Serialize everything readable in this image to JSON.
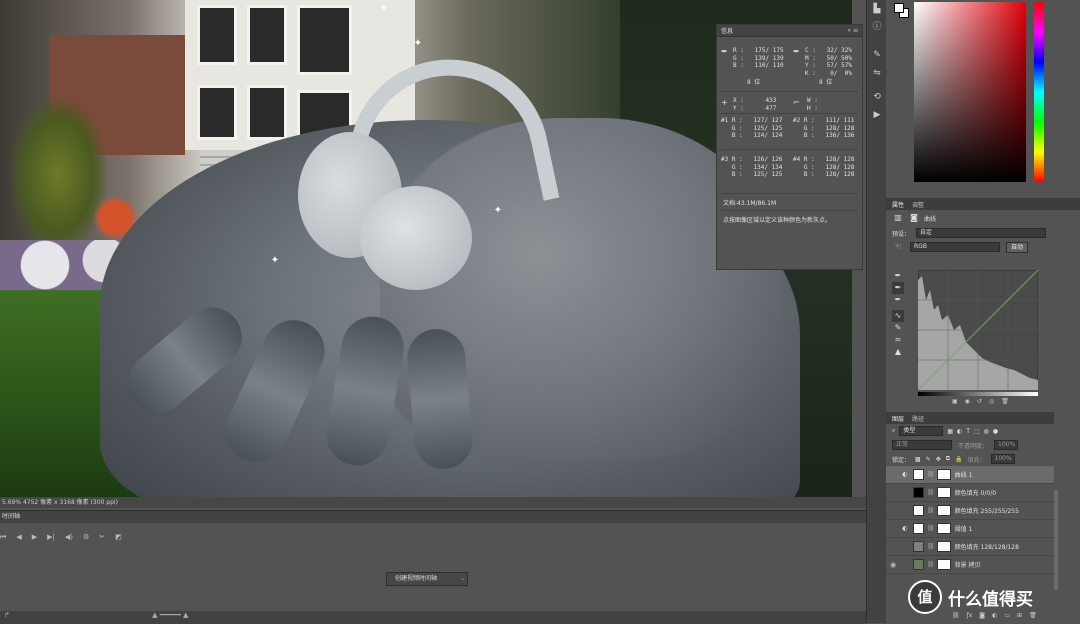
{
  "info_panel": {
    "title": "信息",
    "rgb_block": "R :   175/ 175\nG :   139/ 139\nB :   110/ 110",
    "bit_left": "8 位",
    "cmyk_block": "C :   32/ 32%\nM :   50/ 50%\nY :   57/ 57%\nK :    0/  0%",
    "bit_right": "8 位",
    "xy_block": "X :      433\nY :      477",
    "wh_block": "W :\nH :",
    "s1": "#1 R :   127/ 127\n   G :   125/ 125\n   B :   124/ 124",
    "s2": "#2 R :   111/ 111\n   G :   128/ 128\n   B :   136/ 136",
    "s3": "#3 R :   126/ 126\n   G :   134/ 134\n   B :   125/ 125",
    "s4": "#4 R :   128/ 128\n   G :   128/ 128\n   B :   128/ 128",
    "doc": "文档:43.1M/86.1M",
    "hint": "点按图像区域以定义该种颜色为新灰点。"
  },
  "properties": {
    "tab_active": "属性",
    "tab_other": "调整",
    "adj_name": "曲线",
    "preset_label": "预设：",
    "preset_value": "自定",
    "channel_value": "RGB",
    "auto_button": "自动"
  },
  "layers_panel": {
    "tab_active": "图层",
    "tab_other": "路径",
    "filter_kind": "类型",
    "blend_mode": "正常",
    "opacity_label": "不透明度：",
    "opacity_value": "100%",
    "lock_label": "锁定：",
    "fill_label": "填充：",
    "fill_value": "100%",
    "layers": [
      {
        "name": "曲线 1",
        "swatch": "#ffffff",
        "icon": "◐"
      },
      {
        "name": "颜色填充 0/0/0",
        "swatch": "#000000",
        "icon": ""
      },
      {
        "name": "颜色填充 255/255/255",
        "swatch": "#ffffff",
        "icon": ""
      },
      {
        "name": "阈值 1",
        "swatch": "#ffffff",
        "icon": "◐"
      },
      {
        "name": "颜色填充 128/128/128",
        "swatch": "#808080",
        "icon": ""
      },
      {
        "name": "背景 拷贝",
        "swatch": "#6b7a5a",
        "icon": ""
      }
    ]
  },
  "status_bar": "5.69%    4752 像素 x 3168 像素 (300 ppi)",
  "timeline": {
    "title": "时间轴",
    "create_button": "创建视频时间轴"
  },
  "watermark": {
    "logo": "值",
    "text": "什么值得买"
  },
  "colors": {
    "ps_panel": "#535353",
    "ps_dark": "#424242",
    "curve_line": "#6ab04c"
  }
}
